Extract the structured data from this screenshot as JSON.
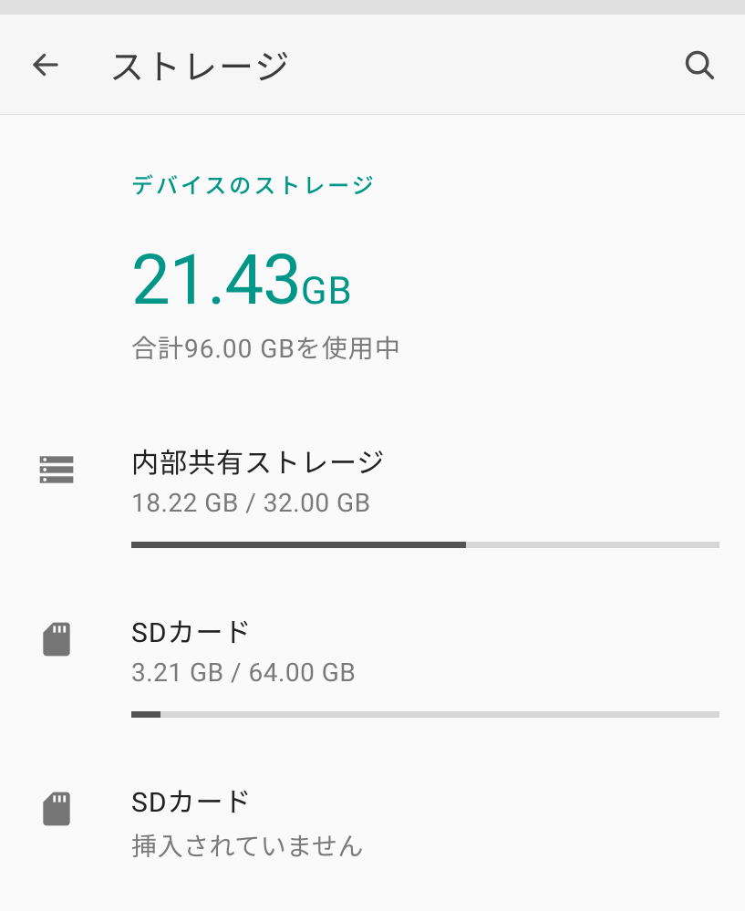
{
  "header": {
    "title": "ストレージ"
  },
  "section_label": "デバイスのストレージ",
  "summary": {
    "value": "21.43",
    "unit": "GB",
    "subtext": "合計96.00 GBを使用中"
  },
  "items": [
    {
      "title": "内部共有ストレージ",
      "subtext": "18.22 GB / 32.00 GB",
      "progress_percent": 56.9,
      "icon": "storage"
    },
    {
      "title": "SDカード",
      "subtext": "3.21 GB / 64.00 GB",
      "progress_percent": 5.0,
      "icon": "sd"
    },
    {
      "title": "SDカード",
      "subtext": "挿入されていません",
      "progress_percent": null,
      "icon": "sd"
    }
  ]
}
